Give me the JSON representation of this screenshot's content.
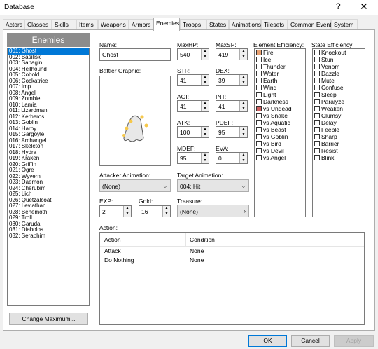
{
  "window": {
    "title": "Database",
    "help": "?",
    "close": "✕"
  },
  "tabs": [
    "Actors",
    "Classes",
    "Skills",
    "Items",
    "Weapons",
    "Armors",
    "Enemies",
    "Troops",
    "States",
    "Animations",
    "Tilesets",
    "Common Events",
    "System"
  ],
  "active_tab": "Enemies",
  "list": {
    "header": "Enemies",
    "items": [
      "001: Ghost",
      "002: Basilisk",
      "003: Sahagin",
      "004: Hellhound",
      "005: Cobold",
      "006: Cockatrice",
      "007: Imp",
      "008: Angel",
      "009: Zombie",
      "010: Lamia",
      "011: Lizardman",
      "012: Kerberos",
      "013: Goblin",
      "014: Harpy",
      "015: Gargoyle",
      "016: Archangel",
      "017: Skeleton",
      "018: Hydra",
      "019: Kraken",
      "020: Griffin",
      "021: Ogre",
      "022: Wyvern",
      "023: Daemon",
      "024: Cherubim",
      "025: Lich",
      "026: Quetzalcoatl",
      "027: Leviathan",
      "028: Behemoth",
      "029: Troll",
      "030: Garuda",
      "031: Diabolos",
      "032: Seraphim"
    ],
    "selected": "001: Ghost",
    "change_max": "Change Maximum..."
  },
  "form": {
    "name_label": "Name:",
    "name": "Ghost",
    "graphic_label": "Battler Graphic:",
    "maxhp_label": "MaxHP:",
    "maxhp": "540",
    "maxsp_label": "MaxSP:",
    "maxsp": "419",
    "str_label": "STR:",
    "str": "41",
    "dex_label": "DEX:",
    "dex": "39",
    "agi_label": "AGI:",
    "agi": "41",
    "int_label": "INT:",
    "int": "41",
    "atk_label": "ATK:",
    "atk": "100",
    "pdef_label": "PDEF:",
    "pdef": "95",
    "mdef_label": "MDEF:",
    "mdef": "95",
    "eva_label": "EVA:",
    "eva": "0",
    "attacker_anim_label": "Attacker Animation:",
    "attacker_anim": "(None)",
    "target_anim_label": "Target Animation:",
    "target_anim": "004: Hit",
    "exp_label": "EXP:",
    "exp": "2",
    "gold_label": "Gold:",
    "gold": "16",
    "treasure_label": "Treasure:",
    "treasure": "(None)",
    "action_label": "Action:",
    "action_cols": [
      "Action",
      "Condition"
    ],
    "actions": [
      {
        "action": "Attack",
        "condition": "None"
      },
      {
        "action": "Do Nothing",
        "condition": "None"
      }
    ]
  },
  "element_efficiency": {
    "label": "Element Efficiency:",
    "items": [
      "Fire",
      "Ice",
      "Thunder",
      "Water",
      "Earth",
      "Wind",
      "Light",
      "Darkness",
      "vs Undead",
      "vs Snake",
      "vs Aquatic",
      "vs Beast",
      "vs Goblin",
      "vs Bird",
      "vs Devil",
      "vs Angel"
    ],
    "marks": {
      "Fire": "E",
      "vs Undead": "F"
    }
  },
  "state_efficiency": {
    "label": "State Efficiency:",
    "items": [
      "Knockout",
      "Stun",
      "Venom",
      "Dazzle",
      "Mute",
      "Confuse",
      "Sleep",
      "Paralyze",
      "Weaken",
      "Clumsy",
      "Delay",
      "Feeble",
      "Sharp",
      "Barrier",
      "Resist",
      "Blink"
    ]
  },
  "buttons": {
    "ok": "OK",
    "cancel": "Cancel",
    "apply": "Apply"
  }
}
